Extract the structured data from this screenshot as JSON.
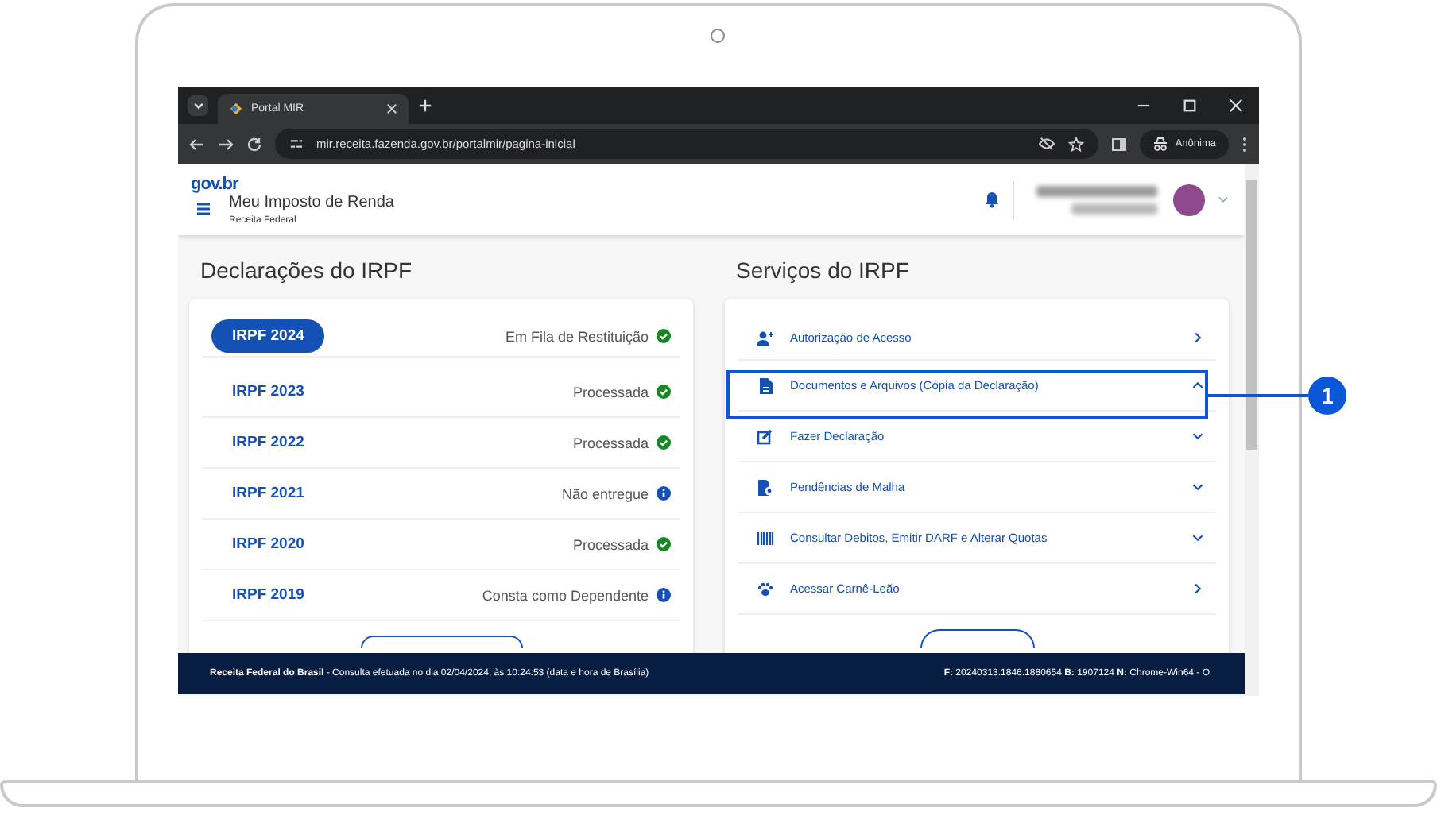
{
  "browser": {
    "tabs": [
      {
        "title": "Portal MIR",
        "selected": true
      }
    ],
    "url": "mir.receita.fazenda.gov.br/portalmir/pagina-inicial",
    "profile": "Anônima"
  },
  "header": {
    "logo": "gov.br",
    "title": "Meu Imposto de Renda",
    "subtitle": "Receita Federal"
  },
  "declarations": {
    "title": "Declarações do IRPF",
    "items": [
      {
        "label": "IRPF 2024",
        "status": "Em Fila de Restituição",
        "kind": "ok",
        "selected": true
      },
      {
        "label": "IRPF 2023",
        "status": "Processada",
        "kind": "ok",
        "selected": false
      },
      {
        "label": "IRPF 2022",
        "status": "Processada",
        "kind": "ok",
        "selected": false
      },
      {
        "label": "IRPF 2021",
        "status": "Não entregue",
        "kind": "info",
        "selected": false
      },
      {
        "label": "IRPF 2020",
        "status": "Processada",
        "kind": "ok",
        "selected": false
      },
      {
        "label": "IRPF 2019",
        "status": "Consta como Dependente",
        "kind": "info",
        "selected": false
      }
    ]
  },
  "services": {
    "title": "Serviços do IRPF",
    "items": [
      {
        "label": "Autorização de Acesso",
        "kind": "link"
      },
      {
        "label": "Documentos e Arquivos (Cópia da Declaração)",
        "kind": "open"
      },
      {
        "label": "Fazer Declaração",
        "kind": "closed"
      },
      {
        "label": "Pendências de Malha",
        "kind": "closed"
      },
      {
        "label": "Consultar Debitos, Emitir DARF e Alterar Quotas",
        "kind": "closed"
      },
      {
        "label": "Acessar Carnê-Leão",
        "kind": "link"
      }
    ]
  },
  "footer": {
    "left": "**Receita Federal do Brasil** - Consulta efetuada no dia 02/04/2024, às 10:24:53 (data e hora de Brasília)",
    "right": "**F:** 20240313.1846.1880654 **B:** 1907124 **N:** Chrome-Win64 - O"
  },
  "callout": {
    "number": "1"
  }
}
